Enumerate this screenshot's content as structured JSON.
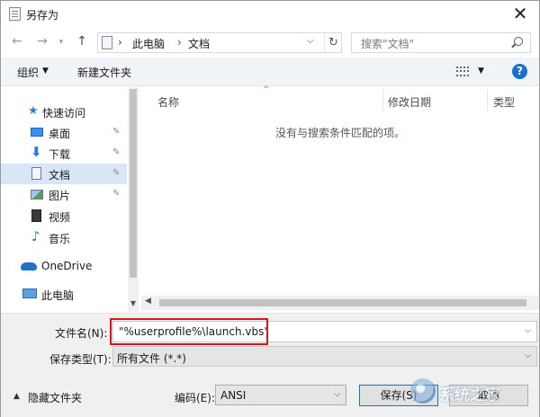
{
  "window": {
    "title": "另存为",
    "close": "✕"
  },
  "nav": {
    "back": "←",
    "forward": "→",
    "recent": "▾",
    "up": "↑",
    "address": {
      "sep": "›",
      "crumbs": [
        "此电脑",
        "文档"
      ],
      "dropdown": "⌵",
      "refresh": "↻"
    },
    "search_placeholder": "搜索\"文档\""
  },
  "commands": {
    "organize": "组织",
    "organize_arrow": "▼",
    "new_folder": "新建文件夹",
    "view_arrow": "▼",
    "help": "?"
  },
  "sidebar": {
    "items": [
      {
        "label": "快速访问",
        "pinned": false,
        "selected": false
      },
      {
        "label": "桌面",
        "pinned": true,
        "selected": false
      },
      {
        "label": "下载",
        "pinned": true,
        "selected": false
      },
      {
        "label": "文档",
        "pinned": true,
        "selected": true
      },
      {
        "label": "图片",
        "pinned": true,
        "selected": false
      },
      {
        "label": "视频",
        "pinned": false,
        "selected": false
      },
      {
        "label": "音乐",
        "pinned": false,
        "selected": false
      },
      {
        "label": "OneDrive",
        "pinned": false,
        "selected": false
      },
      {
        "label": "此电脑",
        "pinned": false,
        "selected": false
      }
    ],
    "pin_glyph": "✎",
    "scroll_down": "▼"
  },
  "content": {
    "sort_indicator": "^",
    "columns": [
      "名称",
      "修改日期",
      "类型"
    ],
    "empty_message": "没有与搜索条件匹配的项。",
    "scroll_left": "◀"
  },
  "form": {
    "filename_label": "文件名(N):",
    "filename_value": "\"%userprofile%\\launch.vbs\"",
    "filetype_label": "保存类型(T):",
    "filetype_value": "所有文件  (*.*)",
    "dropdown": "⌵",
    "hide_folders": "隐藏文件夹",
    "hide_arrow": "▲",
    "encoding_label": "编码(E):",
    "encoding_value": "ANSI",
    "save": "保存(S)",
    "cancel": "取消"
  },
  "watermark": {
    "text": "系统之家"
  }
}
